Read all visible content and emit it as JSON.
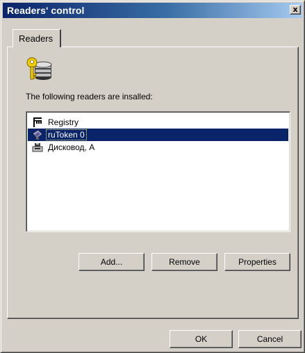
{
  "window": {
    "title": "Readers' control",
    "close_label": "x"
  },
  "tabs": [
    {
      "label": "Readers"
    }
  ],
  "panel": {
    "installed_label": "The following readers are insalled:",
    "readers": [
      {
        "label": "Registry",
        "icon": "registry-icon",
        "selected": false
      },
      {
        "label": "ruToken 0",
        "icon": "token-icon",
        "selected": true
      },
      {
        "label": "Дисковод, A",
        "icon": "floppy-drive-icon",
        "selected": false
      }
    ],
    "buttons": {
      "add": "Add...",
      "remove": "Remove",
      "properties": "Properties"
    }
  },
  "dialog_buttons": {
    "ok": "OK",
    "cancel": "Cancel"
  },
  "colors": {
    "selection": "#0a246a",
    "face": "#d4d0c8",
    "key": "#f0d000"
  }
}
